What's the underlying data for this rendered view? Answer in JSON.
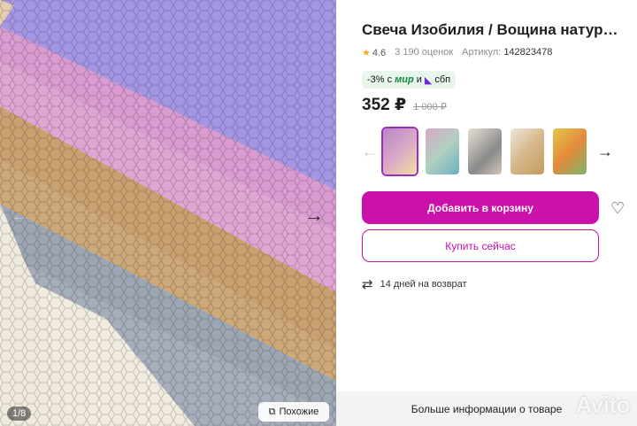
{
  "product": {
    "title": "Свеча Изобилия / Вощина натур…",
    "rating": "4.6",
    "reviews": "3 190 оценок",
    "article_label": "Артикул:",
    "article_value": "142823478"
  },
  "promo": {
    "prefix": "-3% с",
    "mir": "мир",
    "conj": "и",
    "sbp": "сбп"
  },
  "price": {
    "current": "352 ₽",
    "old": "1 000 ₽"
  },
  "gallery": {
    "counter": "1/8",
    "similar_label": "Похожие",
    "thumb_colors": [
      "#b786c9",
      "#d9a7c7",
      "#c9b7a0",
      "#d6b78a",
      "#e2c74a"
    ]
  },
  "actions": {
    "add_to_cart": "Добавить в корзину",
    "buy_now": "Купить сейчас"
  },
  "returns": {
    "text": "14 дней на возврат"
  },
  "footer": {
    "more_info": "Больше информации о товаре"
  },
  "watermark": "Avito",
  "colors": {
    "accent": "#cb11ab",
    "promo_bg": "#e8f6ec"
  }
}
